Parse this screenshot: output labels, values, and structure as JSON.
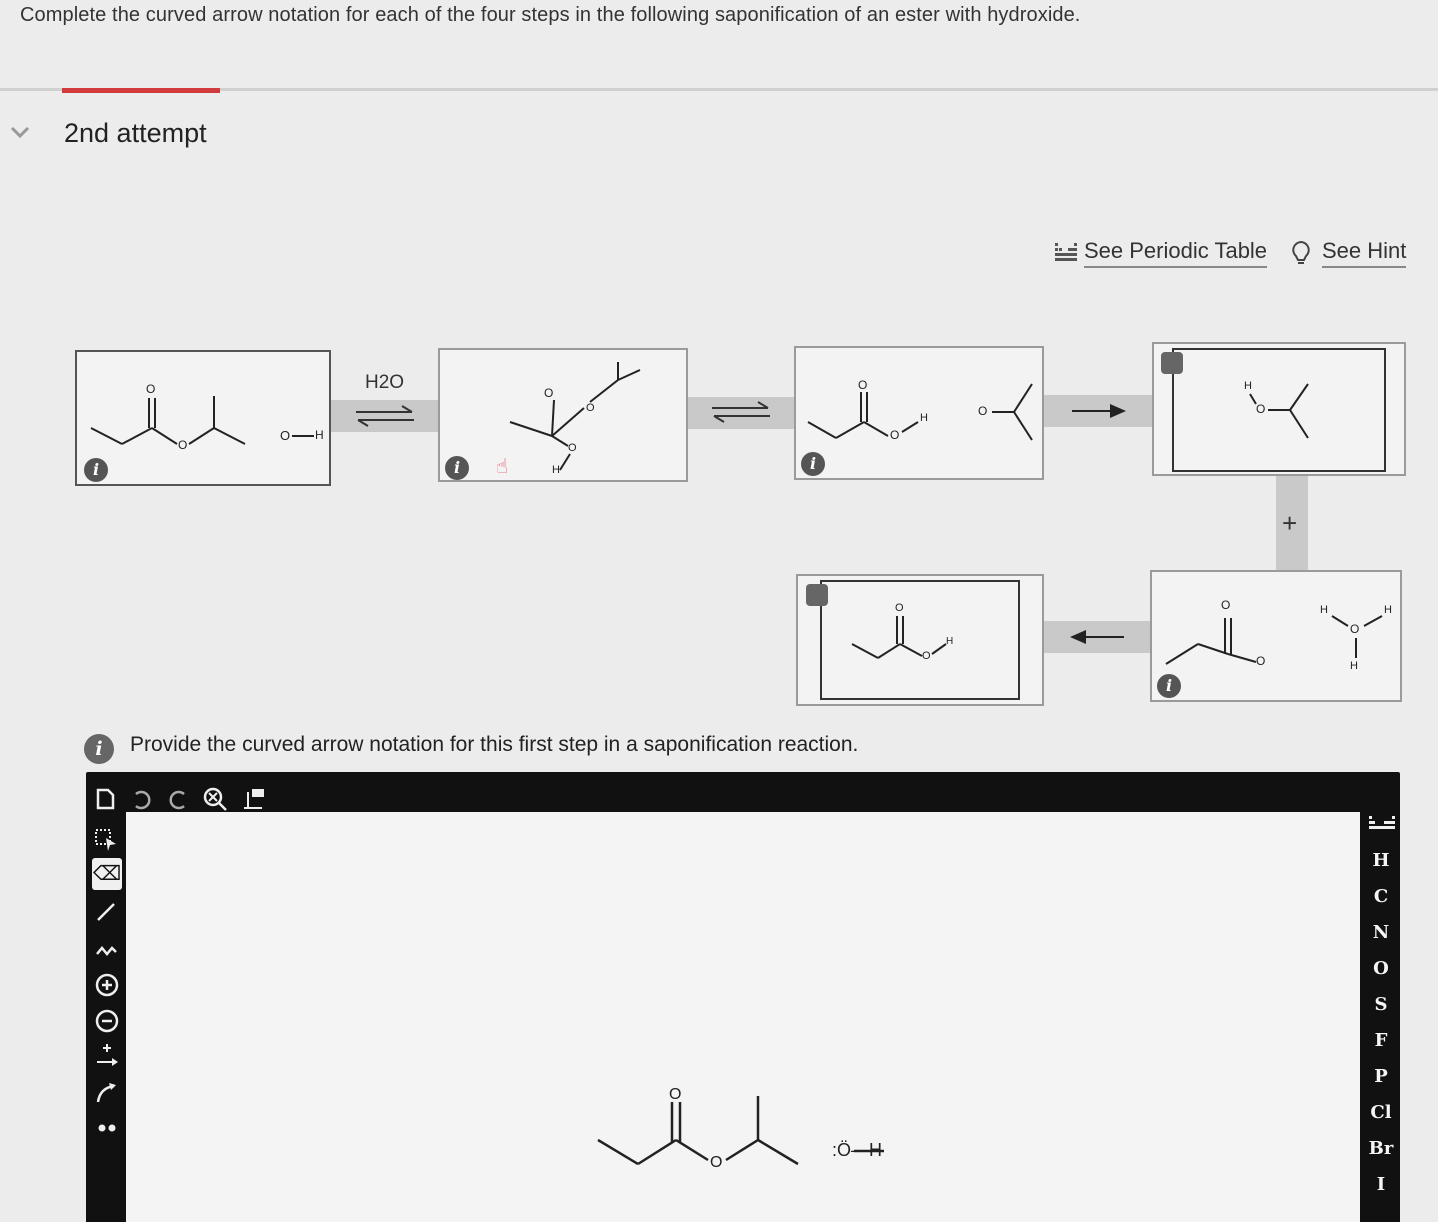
{
  "question": "Complete the curved arrow notation for each of the four steps in the following saponification of an ester with hydroxide.",
  "attempt_label": "2nd attempt",
  "links": {
    "periodic_table": "See Periodic Table",
    "hint": "See Hint"
  },
  "reagent": "H2O",
  "plus": "+",
  "prompt": "Provide the curved arrow notation for this first step in a saponification reaction.",
  "labels": {
    "h": "H",
    "o": "O",
    "oh": ":Ö—H",
    "info": "i"
  },
  "toolbar": {
    "icons": [
      "new-document-icon",
      "undo-icon",
      "redo-icon",
      "zoom-reset-icon",
      "clean-2d-icon"
    ]
  },
  "left_tools": [
    "select-icon",
    "eraser-icon",
    "bond-icon",
    "chain-icon",
    "positive-charge-icon",
    "negative-charge-icon",
    "add-arrow-icon",
    "curved-arrow-icon",
    "lone-pair-icon"
  ],
  "elements": [
    "H",
    "C",
    "N",
    "O",
    "S",
    "F",
    "P",
    "Cl",
    "Br",
    "I"
  ],
  "colors": {
    "accent_red": "#d23b3b",
    "editor_bg": "#111111",
    "canvas_bg": "#f4f4f4"
  }
}
